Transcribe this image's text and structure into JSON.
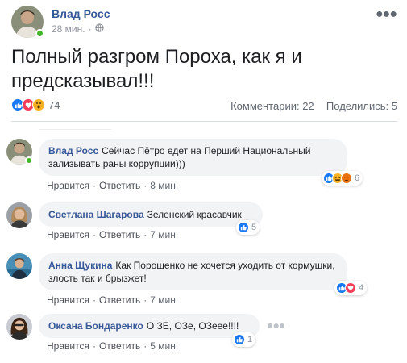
{
  "post": {
    "author": "Влад Росс",
    "time": "28 мин.",
    "privacy_icon": "globe-icon",
    "text": "Полный разгром Пороха, как я и предсказывал!!!",
    "reactions_count": "74",
    "comments_label": "Комментарии: 22",
    "shares_label": "Поделились: 5"
  },
  "comments": [
    {
      "author": "Влад Росс",
      "text": "Сейчас Пётро едет на Перший Национальный зализывать раны коррупции)))",
      "like": "Нравится",
      "reply": "Ответить",
      "time": "8 мин.",
      "reactions": "6"
    },
    {
      "author": "Светлана Шагарова",
      "text": "Зеленский красавчик",
      "like": "Нравится",
      "reply": "Ответить",
      "time": "7 мин.",
      "reactions": "5"
    },
    {
      "author": "Анна Щукина",
      "text": "Как Порошенко не хочется уходить от кормушки, злость так и брызжет!",
      "like": "Нравится",
      "reply": "Ответить",
      "time": "7 мин.",
      "reactions": "4"
    },
    {
      "author": "Оксана Бондаренко",
      "text": "О ЗЕ, ОЗе, ОЗеее!!!!",
      "like": "Нравится",
      "reply": "Ответить",
      "time": "5 мин.",
      "reactions": "1"
    }
  ],
  "colors": {
    "name_blue": "#365899",
    "like_blue": "#1877f2",
    "love_red": "#f33e58",
    "wow_yellow": "#f7b125",
    "bubble_gray": "#f2f3f5"
  }
}
